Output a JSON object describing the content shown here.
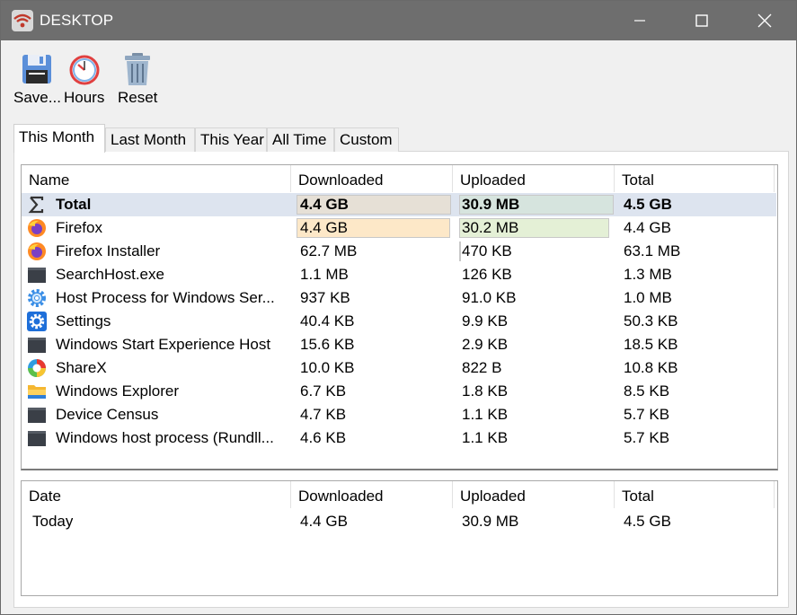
{
  "window": {
    "title": "DESKTOP"
  },
  "toolbar": {
    "save_label": "Save...",
    "hours_label": "Hours",
    "reset_label": "Reset"
  },
  "tabs": [
    {
      "label": "This Month",
      "active": true
    },
    {
      "label": "Last Month",
      "active": false
    },
    {
      "label": "This Year",
      "active": false
    },
    {
      "label": "All Time",
      "active": false
    },
    {
      "label": "Custom",
      "active": false
    }
  ],
  "apps_table": {
    "columns": [
      "Name",
      "Downloaded",
      "Uploaded",
      "Total"
    ],
    "total_row": {
      "name": "Total",
      "downloaded": "4.4 GB",
      "uploaded": "30.9 MB",
      "total": "4.5 GB",
      "icon": "sigma-icon"
    },
    "rows": [
      {
        "name": "Firefox",
        "downloaded": "4.4 GB",
        "uploaded": "30.2 MB",
        "total": "4.4 GB",
        "icon": "firefox-icon"
      },
      {
        "name": "Firefox Installer",
        "downloaded": "62.7 MB",
        "uploaded": "470 KB",
        "total": "63.1 MB",
        "icon": "firefox-icon"
      },
      {
        "name": "SearchHost.exe",
        "downloaded": "1.1 MB",
        "uploaded": "126 KB",
        "total": "1.3 MB",
        "icon": "app-window-icon"
      },
      {
        "name": "Host Process for Windows Ser...",
        "downloaded": "937 KB",
        "uploaded": "91.0 KB",
        "total": "1.0 MB",
        "icon": "gear-light-icon"
      },
      {
        "name": "Settings",
        "downloaded": "40.4 KB",
        "uploaded": "9.9 KB",
        "total": "50.3 KB",
        "icon": "settings-gear-icon"
      },
      {
        "name": "Windows Start Experience Host",
        "downloaded": "15.6 KB",
        "uploaded": "2.9 KB",
        "total": "18.5 KB",
        "icon": "app-window-icon"
      },
      {
        "name": "ShareX",
        "downloaded": "10.0 KB",
        "uploaded": "822 B",
        "total": "10.8 KB",
        "icon": "sharex-icon"
      },
      {
        "name": "Windows Explorer",
        "downloaded": "6.7 KB",
        "uploaded": "1.8 KB",
        "total": "8.5 KB",
        "icon": "folder-icon"
      },
      {
        "name": "Device Census",
        "downloaded": "4.7 KB",
        "uploaded": "1.1 KB",
        "total": "5.7 KB",
        "icon": "app-window-icon"
      },
      {
        "name": "Windows host process (Rundll...",
        "downloaded": "4.6 KB",
        "uploaded": "1.1 KB",
        "total": "5.7 KB",
        "icon": "app-window-icon"
      }
    ]
  },
  "dates_table": {
    "columns": [
      "Date",
      "Downloaded",
      "Uploaded",
      "Total"
    ],
    "rows": [
      {
        "date": "Today",
        "downloaded": "4.4 GB",
        "uploaded": "30.9 MB",
        "total": "4.5 GB"
      }
    ]
  },
  "colors": {
    "titlebar": "#6e6e6e",
    "selected_row": "#dde4ef",
    "download_bar": "#fde8c8",
    "upload_bar": "#e4f0d6",
    "total_download_bar": "#e6e0d6",
    "total_upload_bar": "#d6e4de"
  }
}
